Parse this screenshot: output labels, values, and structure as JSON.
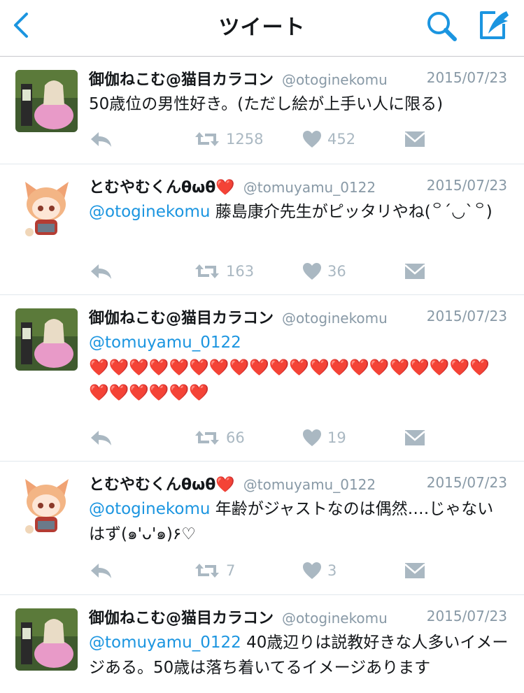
{
  "header": {
    "title": "ツイート",
    "back_icon": "chevron-left-icon",
    "search_icon": "search-icon",
    "compose_icon": "compose-icon",
    "accent": "#1b95e0"
  },
  "tweets": [
    {
      "name": "御伽ねこむ@猫目カラコン",
      "handle": "@otoginekomu",
      "date": "2015/07/23",
      "mention": "",
      "text": "50歳位の男性好き。(ただし絵が上手い人に限る)",
      "retweets": "1258",
      "likes": "452",
      "avatar": "photo-avatar"
    },
    {
      "name": "とむやむくんθωθ❤️",
      "handle": "@tomuyamu_0122",
      "date": "2015/07/23",
      "mention": "@otoginekomu",
      "text": " 藤島康介先生がピッタリやね(꒪ˊ◡ˋ꒪)",
      "retweets": "163",
      "likes": "36",
      "avatar": "anime-avatar"
    },
    {
      "name": "御伽ねこむ@猫目カラコン",
      "handle": "@otoginekomu",
      "date": "2015/07/23",
      "mention": "@tomuyamu_0122",
      "text": "❤️❤️❤️❤️❤️❤️❤️❤️❤️❤️❤️❤️❤️❤️❤️❤️❤️❤️❤️❤️❤️❤️❤️❤️❤️❤️",
      "retweets": "66",
      "likes": "19",
      "avatar": "photo-avatar"
    },
    {
      "name": "とむやむくんθωθ❤️",
      "handle": "@tomuyamu_0122",
      "date": "2015/07/23",
      "mention": "@otoginekomu",
      "text": " 年齢がジャストなのは偶然‥‥じゃないはず(๑'ᴗ'๑)۶♡",
      "retweets": "7",
      "likes": "3",
      "avatar": "anime-avatar"
    },
    {
      "name": "御伽ねこむ@猫目カラコン",
      "handle": "@otoginekomu",
      "date": "2015/07/23",
      "mention": "@tomuyamu_0122",
      "text": " 40歳辺りは説教好きな人多いイメージある。50歳は落ち着いてるイメージあります",
      "retweets": "",
      "likes": "",
      "avatar": "photo-avatar"
    }
  ]
}
